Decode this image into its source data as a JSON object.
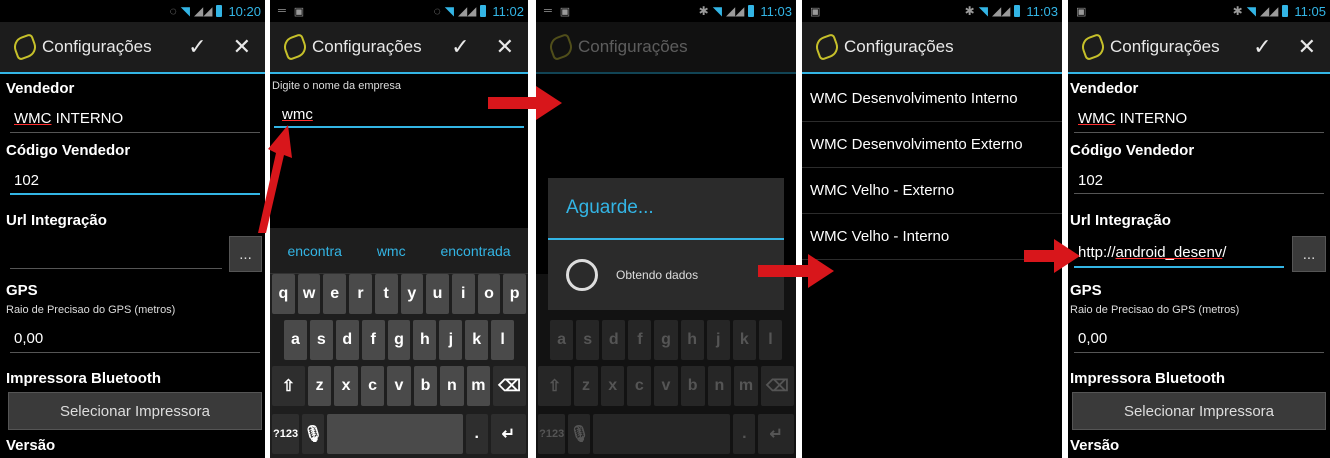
{
  "screens": [
    {
      "status": {
        "time": "10:20"
      },
      "action_bar": {
        "title": "Configurações",
        "confirm_icon": "check-icon",
        "close_icon": "close-icon"
      },
      "vendedor": {
        "label": "Vendedor",
        "value_marked": "WMC",
        "value_rest": " INTERNO"
      },
      "codigo": {
        "label": "Código Vendedor",
        "value": "102"
      },
      "url": {
        "label": "Url Integração",
        "value": "",
        "button": "..."
      },
      "gps": {
        "label": "GPS",
        "sublabel": "Raio de Precisao do GPS (metros)",
        "value": "0,00"
      },
      "impressora": {
        "label": "Impressora Bluetooth",
        "button": "Selecionar Impressora"
      },
      "versao": {
        "label": "Versão"
      }
    },
    {
      "status": {
        "time": "11:02"
      },
      "action_bar": {
        "title": "Configurações"
      },
      "prompt": "Digite o nome da empresa",
      "input_value": "wmc",
      "suggestions": [
        "encontra",
        "wmc",
        "encontrada"
      ],
      "keys_row1": [
        "q",
        "w",
        "e",
        "r",
        "t",
        "y",
        "u",
        "i",
        "o",
        "p"
      ],
      "keys_row2": [
        "a",
        "s",
        "d",
        "f",
        "g",
        "h",
        "j",
        "k",
        "l"
      ],
      "keys_row3": [
        "z",
        "x",
        "c",
        "v",
        "b",
        "n",
        "m"
      ],
      "key_symbols": "?123"
    },
    {
      "status": {
        "time": "11:03"
      },
      "action_bar": {
        "title": "Configurações"
      },
      "dialog": {
        "title": "Aguarde...",
        "message": "Obtendo dados"
      },
      "keys_row2": [
        "a",
        "s",
        "d",
        "f",
        "g",
        "h",
        "j",
        "k",
        "l"
      ],
      "keys_row3": [
        "z",
        "x",
        "c",
        "v",
        "b",
        "n",
        "m"
      ],
      "key_symbols": "?123"
    },
    {
      "status": {
        "time": "11:03"
      },
      "action_bar": {
        "title": "Configurações"
      },
      "companies": [
        "WMC Desenvolvimento Interno",
        "WMC Desenvolvimento Externo",
        "WMC Velho - Externo",
        "WMC Velho - Interno"
      ]
    },
    {
      "status": {
        "time": "11:05"
      },
      "action_bar": {
        "title": "Configurações"
      },
      "vendedor": {
        "label": "Vendedor",
        "value_marked": "WMC",
        "value_rest": " INTERNO"
      },
      "codigo": {
        "label": "Código Vendedor",
        "value": "102"
      },
      "url": {
        "label": "Url Integração",
        "value_plain": "http://",
        "value_marked": "android_desenv",
        "value_tail": "/",
        "button": "..."
      },
      "gps": {
        "label": "GPS",
        "sublabel": "Raio de Precisao do GPS (metros)",
        "value": "0,00"
      },
      "impressora": {
        "label": "Impressora Bluetooth",
        "button": "Selecionar Impressora"
      },
      "versao": {
        "label": "Versão"
      }
    }
  ],
  "colors": {
    "accent": "#33b5e5",
    "arrow": "#d8161b",
    "background": "#000000"
  }
}
